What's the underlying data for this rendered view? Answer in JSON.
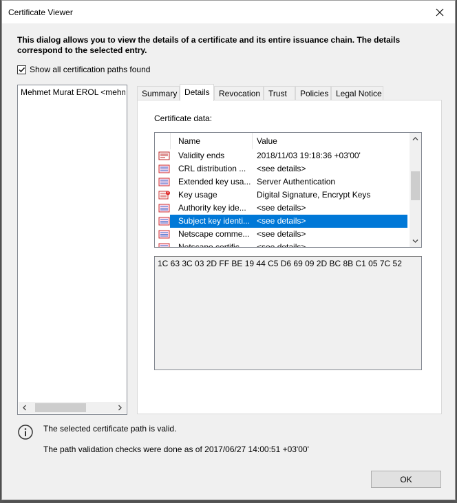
{
  "window": {
    "title": "Certificate Viewer"
  },
  "intro": "This dialog allows you to view the details of a certificate and its entire issuance chain. The details correspond to the selected entry.",
  "show_all_paths": {
    "label": "Show all certification paths found",
    "checked": true
  },
  "chain": {
    "items": [
      "Mehmet Murat EROL <mehmet.erol"
    ]
  },
  "tabs": [
    "Summary",
    "Details",
    "Revocation",
    "Trust",
    "Policies",
    "Legal Notice"
  ],
  "active_tab": "Details",
  "details": {
    "certificate_data_label": "Certificate data:",
    "columns": [
      "Name",
      "Value"
    ],
    "rows": [
      {
        "icon": "cert-field-icon",
        "name": "Validity ends",
        "value": "2018/11/03 19:18:36 +03'00'"
      },
      {
        "icon": "cert-extension-icon",
        "name": "CRL distribution ...",
        "value": "<see details>"
      },
      {
        "icon": "cert-extension-icon",
        "name": "Extended key usa...",
        "value": "Server Authentication"
      },
      {
        "icon": "cert-critical-extension-icon",
        "name": "Key usage",
        "value": "Digital Signature, Encrypt Keys"
      },
      {
        "icon": "cert-extension-icon",
        "name": "Authority key ide...",
        "value": "<see details>"
      },
      {
        "icon": "cert-extension-icon",
        "name": "Subject key identi...",
        "value": "<see details>",
        "selected": true
      },
      {
        "icon": "cert-extension-icon",
        "name": "Netscape comme...",
        "value": "<see details>"
      },
      {
        "icon": "cert-extension-icon",
        "name": "Netscape certific...",
        "value": "<see details>"
      }
    ],
    "selected_value": "1C 63 3C 03 2D FF BE 19 44 C5 D6 69 09 2D BC 8B C1 05 7C 52"
  },
  "status": {
    "valid_text": "The selected certificate path is valid.",
    "checked_text": "The path validation checks were done as of 2017/06/27 14:00:51 +03'00'"
  },
  "buttons": {
    "ok": "OK"
  },
  "colors": {
    "selection": "#0078d7",
    "dialog_bg": "#f0f0f0",
    "border": "#828790"
  }
}
